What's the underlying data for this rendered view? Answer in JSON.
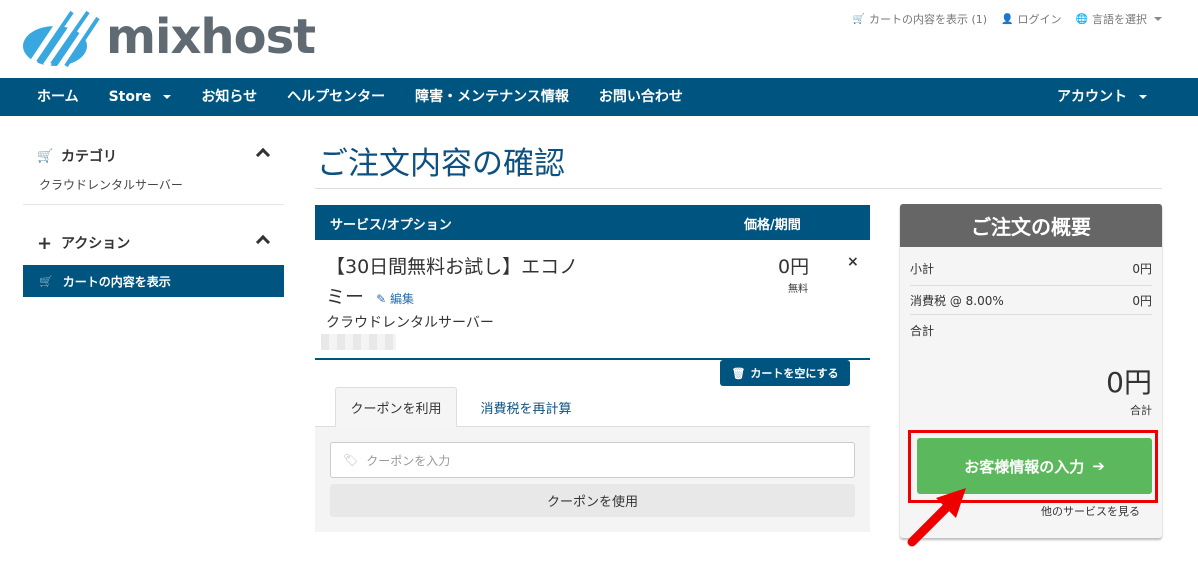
{
  "brand": {
    "name": "mixhost"
  },
  "topbar": {
    "cart": "カートの内容を表示 (1)",
    "login": "ログイン",
    "language": "言語を選択"
  },
  "nav": {
    "home": "ホーム",
    "store": "Store",
    "news": "お知らせ",
    "help": "ヘルプセンター",
    "maintenance": "障害・メンテナンス情報",
    "contact": "お問い合わせ",
    "account": "アカウント"
  },
  "sidebar": {
    "category_title": "カテゴリ",
    "category_item": "クラウドレンタルサーバー",
    "action_title": "アクション",
    "action_item": "カートの内容を表示"
  },
  "page": {
    "title": "ご注文内容の確認"
  },
  "cart": {
    "col_service": "サービス/オプション",
    "col_price": "価格/期間",
    "item_name_line1": "【30日間無料お試し】エコノ",
    "item_name_line2": "ミー",
    "edit": "編集",
    "item_category": "クラウドレンタルサーバー",
    "price": "0円",
    "price_note": "無料",
    "remove": "×",
    "empty_button": "カートを空にする"
  },
  "tabs": {
    "coupon": "クーポンを利用",
    "tax": "消費税を再計算"
  },
  "coupon": {
    "placeholder": "クーポンを入力",
    "apply": "クーポンを使用"
  },
  "summary": {
    "title": "ご注文の概要",
    "subtotal_label": "小計",
    "subtotal_value": "0円",
    "tax_label": "消費税 @ 8.00%",
    "tax_value": "0円",
    "total_label": "合計",
    "total_value": "0円",
    "total_caption": "合計",
    "checkout": "お客様情報の入力",
    "continue": "他のサービスを見る"
  },
  "colors": {
    "primary": "#005580",
    "title": "#0d5180",
    "success": "#5cb85c",
    "summary_header": "#666666",
    "highlight": "#ee0000"
  }
}
